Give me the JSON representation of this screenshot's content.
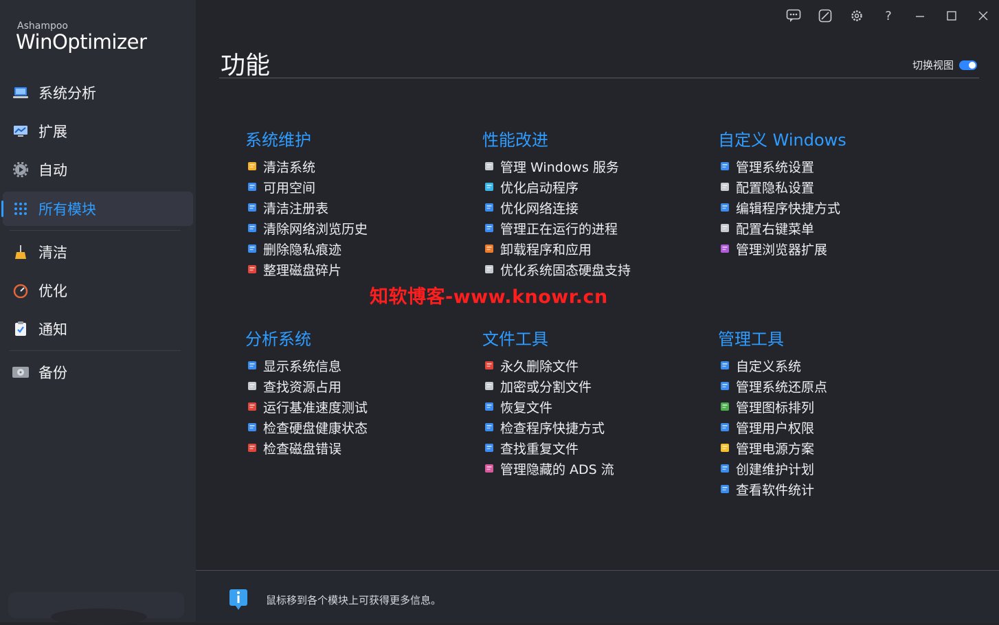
{
  "sidebar": {
    "brand_small": "Ashampoo",
    "brand_big": "WinOptimizer",
    "items": [
      {
        "label": "系统分析",
        "icon": "laptop-icon"
      },
      {
        "label": "扩展",
        "icon": "monitor-chart-icon"
      },
      {
        "label": "自动",
        "icon": "gear-play-icon"
      },
      {
        "label": "所有模块",
        "icon": "grid-icon",
        "active": true
      },
      {
        "label": "清洁",
        "icon": "broom-icon"
      },
      {
        "label": "优化",
        "icon": "speedometer-icon"
      },
      {
        "label": "通知",
        "icon": "clipboard-check-icon"
      },
      {
        "label": "备份",
        "icon": "hard-drive-icon"
      }
    ]
  },
  "topbar": {
    "icons": [
      "feedback-icon",
      "theme-icon",
      "settings-icon",
      "help-icon",
      "minimize-icon",
      "maximize-icon",
      "close-icon"
    ],
    "help_label": "?"
  },
  "main": {
    "title": "功能",
    "view_toggle_label": "切换视图",
    "view_toggle_on": true,
    "groups": [
      {
        "title": "系统维护",
        "items": [
          "清洁系统",
          "可用空间",
          "清洁注册表",
          "清除网络浏览历史",
          "删除隐私痕迹",
          "整理磁盘碎片"
        ]
      },
      {
        "title": "性能改进",
        "items": [
          "管理 Windows 服务",
          "优化启动程序",
          "优化网络连接",
          "管理正在运行的进程",
          "卸载程序和应用",
          "优化系统固态硬盘支持"
        ]
      },
      {
        "title": "自定义 Windows",
        "items": [
          "管理系统设置",
          "配置隐私设置",
          "编辑程序快捷方式",
          "配置右键菜单",
          "管理浏览器扩展"
        ]
      },
      {
        "title": "分析系统",
        "items": [
          "显示系统信息",
          "查找资源占用",
          "运行基准速度测试",
          "检查硬盘健康状态",
          "检查磁盘错误"
        ]
      },
      {
        "title": "文件工具",
        "items": [
          "永久删除文件",
          "加密或分割文件",
          "恢复文件",
          "检查程序快捷方式",
          "查找重复文件",
          "管理隐藏的 ADS 流"
        ]
      },
      {
        "title": "管理工具",
        "items": [
          "自定义系统",
          "管理系统还原点",
          "管理图标排列",
          "管理用户权限",
          "管理电源方案",
          "创建维护计划",
          "查看软件统计"
        ]
      }
    ],
    "item_icon_colors": [
      [
        "#f5b12a",
        "#3a8cf0",
        "#3a8cf0",
        "#3a8cf0",
        "#3a8cf0",
        "#e2453a"
      ],
      [
        "#c7cbd2",
        "#3ab5e8",
        "#3a8cf0",
        "#3a8cf0",
        "#ef7a2a",
        "#c7cbd2"
      ],
      [
        "#3a8cf0",
        "#c7cbd2",
        "#3a8cf0",
        "#c7cbd2",
        "#b25ad9"
      ],
      [
        "#3a8cf0",
        "#c7cbd2",
        "#e2453a",
        "#3a8cf0",
        "#e2453a"
      ],
      [
        "#e2453a",
        "#c7cbd2",
        "#3a8cf0",
        "#3a8cf0",
        "#3a8cf0",
        "#d95a9c"
      ],
      [
        "#3a8cf0",
        "#3a8cf0",
        "#4cae4c",
        "#3a8cf0",
        "#f5c02a",
        "#3a8cf0",
        "#3a8cf0"
      ]
    ]
  },
  "watermark": "知软博客-www.knowr.cn",
  "footer": {
    "hint": "鼠标移到各个模块上可获得更多信息。"
  },
  "colors": {
    "accent": "#2f9cff",
    "watermark": "#ff1e1e"
  }
}
